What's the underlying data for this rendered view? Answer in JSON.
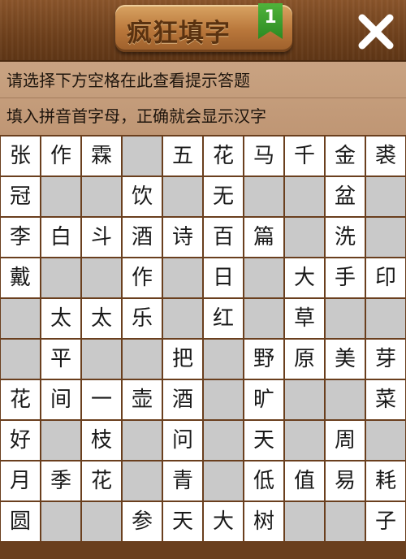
{
  "header": {
    "title": "疯狂填字",
    "level": "1",
    "close_icon": "close-x-icon"
  },
  "hints": {
    "line1": "请选择下方空格在此查看提示答题",
    "line2": "填入拼音首字母，正确就会显示汉字"
  },
  "colors": {
    "board_border": "#6a3f1e",
    "letter_cell": "#ffffff",
    "blank_cell": "#c9c9c9",
    "hint_bar": "#c9a382"
  },
  "grid": [
    [
      "张",
      "作",
      "霖",
      "#",
      "五",
      "花",
      "马",
      "千",
      "金",
      "裘"
    ],
    [
      "冠",
      "",
      "",
      "饮",
      "",
      "无",
      "",
      "",
      "盆",
      ""
    ],
    [
      "李",
      "白",
      "斗",
      "酒",
      "诗",
      "百",
      "篇",
      "",
      "洗",
      ""
    ],
    [
      "戴",
      "",
      "",
      "作",
      "",
      "日",
      "",
      "大",
      "手",
      "印"
    ],
    [
      "",
      "太",
      "太",
      "乐",
      "",
      "红",
      "",
      "草",
      "",
      ""
    ],
    [
      "",
      "平",
      "",
      "",
      "把",
      "",
      "野",
      "原",
      "美",
      "芽"
    ],
    [
      "花",
      "间",
      "一",
      "壶",
      "酒",
      "",
      "旷",
      "",
      "",
      "菜"
    ],
    [
      "好",
      "",
      "枝",
      "",
      "问",
      "",
      "天",
      "",
      "周",
      ""
    ],
    [
      "月",
      "季",
      "花",
      "",
      "青",
      "",
      "低",
      "值",
      "易",
      "耗"
    ],
    [
      "圆",
      "",
      "",
      "参",
      "天",
      "大",
      "树",
      "",
      "",
      "子"
    ]
  ],
  "cell_types": [
    "WWWGWWWWWW",
    "WGGWGWGGWG",
    "WWWWWWWGWG",
    "WGGWGWGWWW",
    "GWWWGWGWGG",
    "GWGGWGWWWW",
    "WWWWWGWGGW",
    "WGWGWGWGWG",
    "WWWGWGWWWW",
    "WGGWWWWGGW"
  ]
}
